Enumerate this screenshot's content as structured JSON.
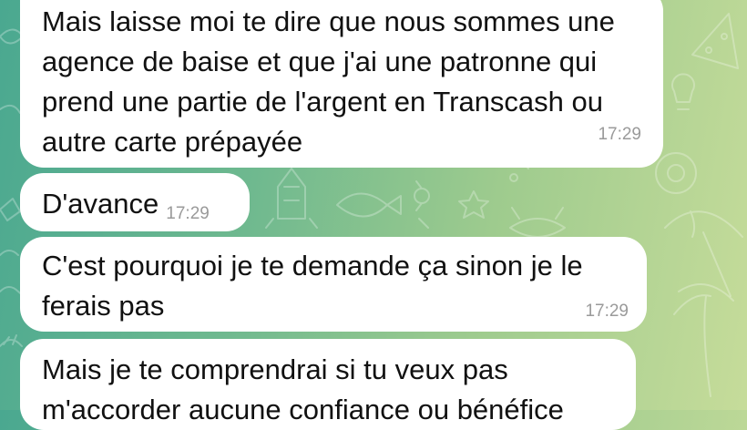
{
  "chat": {
    "messages": [
      {
        "text": "Mais laisse moi te dire que nous sommes une agence de baise et que j'ai une patronne qui prend une partie de l'argent en Transcash ou autre carte prépayée",
        "time": "17:29"
      },
      {
        "text": "D'avance",
        "time": "17:29"
      },
      {
        "text": "C'est pourquoi je te demande ça sinon je le ferais pas",
        "time": "17:29"
      },
      {
        "text": "Mais je te comprendrai si tu veux pas m'accorder aucune confiance ou bénéfice"
      }
    ]
  },
  "colors": {
    "bubble": "#ffffff",
    "timestamp": "#9a9a9a",
    "wallpaper_left": "#4aa890",
    "wallpaper_right": "#c6dc9a"
  }
}
